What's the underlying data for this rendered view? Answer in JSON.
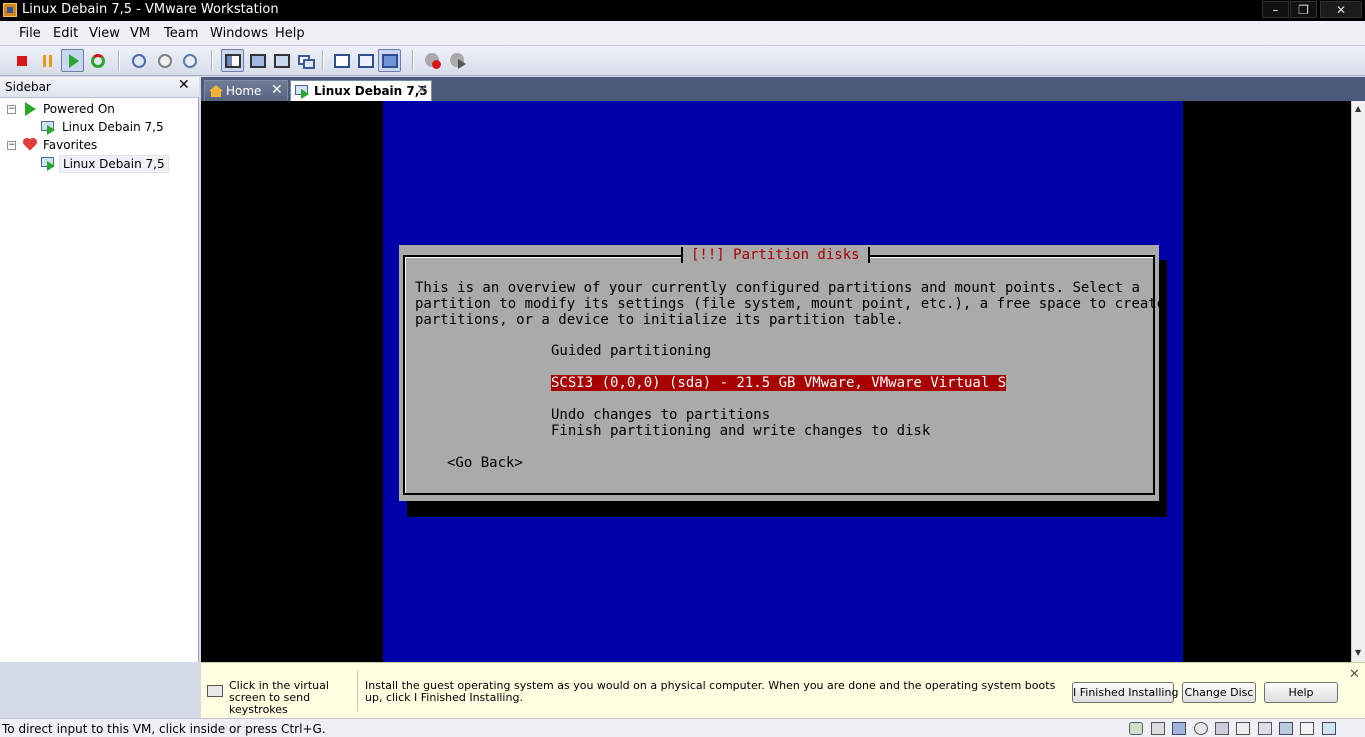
{
  "window": {
    "title": "Linux Debain 7,5 - VMware Workstation",
    "controls": [
      "minimize",
      "restore",
      "close"
    ]
  },
  "menubar": {
    "items": [
      "File",
      "Edit",
      "View",
      "VM",
      "Team",
      "Windows",
      "Help"
    ]
  },
  "toolbar": {
    "buttons": [
      "power-off-icon",
      "suspend-icon",
      "power-on-icon",
      "reset-icon",
      "snapshot-icon",
      "revert-snapshot-icon",
      "snapshot-manager-icon",
      "view-normal-icon",
      "view-full-screen-icon",
      "view-quick-switch-icon",
      "view-console-icon",
      "view-tab-icon",
      "view-summary-icon",
      "view-console-active-icon",
      "record-icon",
      "replay-icon"
    ]
  },
  "sidebar": {
    "title": "Sidebar",
    "groups": [
      {
        "label": "Powered On",
        "toggle": "−",
        "items": [
          {
            "label": "Linux Debain 7,5"
          }
        ]
      },
      {
        "label": "Favorites",
        "toggle": "−",
        "items": [
          {
            "label": "Linux Debain 7,5"
          }
        ]
      }
    ]
  },
  "tabs": [
    {
      "label": "Home",
      "active": false
    },
    {
      "label": "Linux Debain 7,5",
      "active": true
    }
  ],
  "installer": {
    "dialog_title": "[!!] Partition disks",
    "description": "This is an overview of your currently configured partitions and mount points. Select a\npartition to modify its settings (file system, mount point, etc.), a free space to create\npartitions, or a device to initialize its partition table.",
    "options": {
      "guided": "Guided partitioning",
      "disk": "SCSI3 (0,0,0) (sda) - 21.5 GB VMware, VMware Virtual S",
      "undo": "Undo changes to partitions",
      "finish": "Finish partitioning and write changes to disk"
    },
    "go_back": "<Go Back>",
    "colors": {
      "screen_bg": "#0000a8",
      "dialog_bg": "#aaaaaa",
      "title_fg": "#a80000",
      "selected_bg": "#a80000",
      "selected_fg": "#ffffff"
    }
  },
  "hintbar": {
    "left_hint": "Click in the virtual screen to send keystrokes",
    "main_hint": "Install the guest operating system as you would on a physical computer. When you are done and the operating system boots up, click I Finished Installing.",
    "buttons": {
      "finished": "I Finished Installing",
      "change_disc": "Change Disc",
      "help": "Help"
    },
    "close": "✕"
  },
  "statusbar": {
    "text": "To direct input to this VM, click inside or press Ctrl+G.",
    "icons": [
      "network-icon",
      "hard-disk-icon",
      "floppy-icon",
      "cd-icon",
      "usb-icon",
      "printer-icon",
      "sound-icon",
      "display-icon",
      "message-icon",
      "vm-status-icon"
    ]
  }
}
